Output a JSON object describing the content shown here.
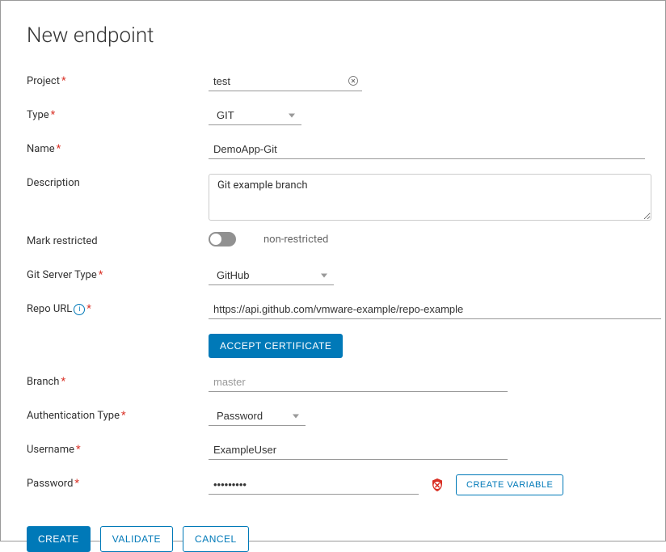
{
  "title": "New endpoint",
  "labels": {
    "project": "Project",
    "type": "Type",
    "name": "Name",
    "description": "Description",
    "markRestricted": "Mark restricted",
    "gitServerType": "Git Server Type",
    "repoUrl": "Repo URL",
    "branch": "Branch",
    "authType": "Authentication Type",
    "username": "Username",
    "password": "Password"
  },
  "values": {
    "project": "test",
    "type": "GIT",
    "name": "DemoApp-Git",
    "description": "Git example branch",
    "restrictedLabel": "non-restricted",
    "gitServerType": "GitHub",
    "repoUrl": "https://api.github.com/vmware-example/repo-example",
    "branchPlaceholder": "master",
    "authType": "Password",
    "username": "ExampleUser",
    "password": "•••••••••"
  },
  "buttons": {
    "acceptCertificate": "Accept Certificate",
    "createVariable": "Create Variable",
    "create": "Create",
    "validate": "Validate",
    "cancel": "Cancel"
  }
}
